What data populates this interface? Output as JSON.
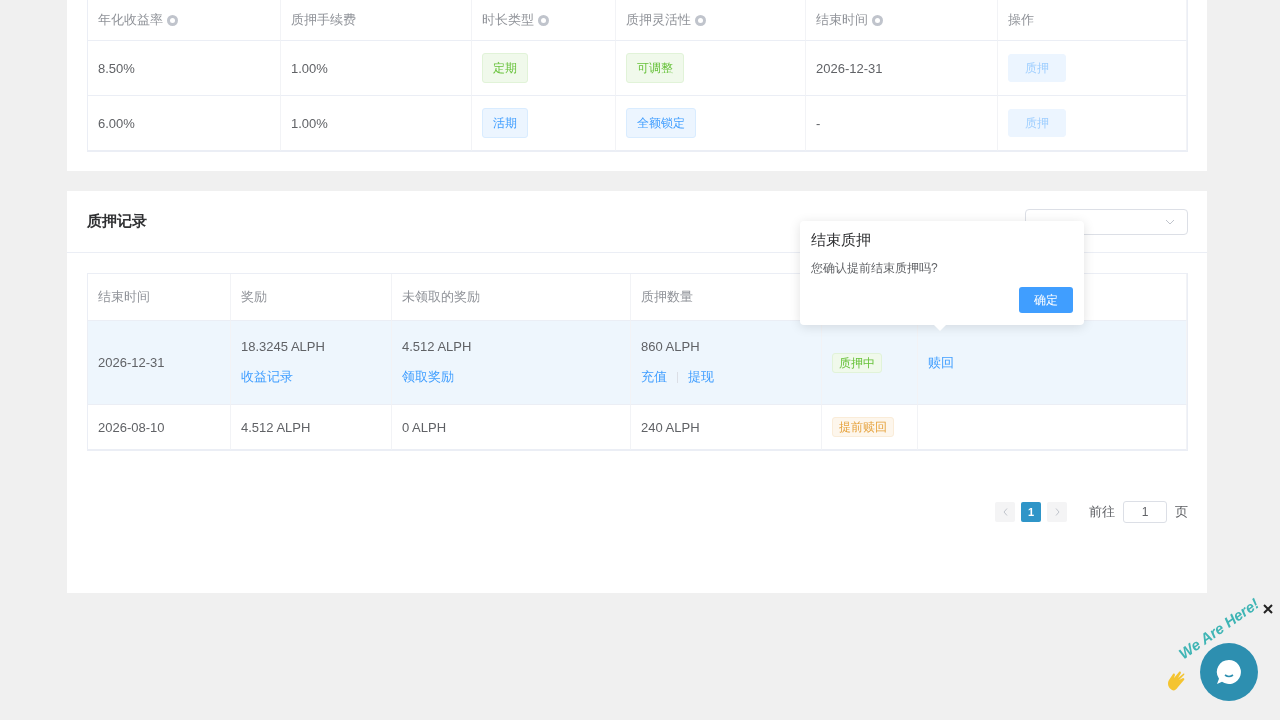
{
  "rates_table": {
    "columns": [
      {
        "label": "年化收益率",
        "help": true
      },
      {
        "label": "质押手续费",
        "help": false
      },
      {
        "label": "时长类型",
        "help": true
      },
      {
        "label": "质押灵活性",
        "help": true
      },
      {
        "label": "结束时间",
        "help": true
      },
      {
        "label": "操作",
        "help": false
      }
    ],
    "rows": [
      {
        "rate": "8.50%",
        "fee": "1.00%",
        "duration": {
          "text": "定期",
          "kind": "success"
        },
        "flexibility": {
          "text": "可调整",
          "kind": "success"
        },
        "end_time": "2026-12-31",
        "action": {
          "label": "质押",
          "disabled": true
        }
      },
      {
        "rate": "6.00%",
        "fee": "1.00%",
        "duration": {
          "text": "活期",
          "kind": "primary"
        },
        "flexibility": {
          "text": "全额锁定",
          "kind": "primary"
        },
        "end_time": "-",
        "action": {
          "label": "质押",
          "disabled": true
        }
      }
    ]
  },
  "records": {
    "title": "质押记录",
    "columns": [
      "结束时间",
      "奖励",
      "未领取的奖励",
      "质押数量"
    ],
    "rows": [
      {
        "highlighted": true,
        "end_time": "2026-12-31",
        "reward": "18.3245 ALPH",
        "reward_links": [
          "收益记录"
        ],
        "unclaimed": "4.512 ALPH",
        "unclaimed_links": [
          "领取奖励"
        ],
        "amount": "860 ALPH",
        "amount_links": [
          "充值",
          "提现"
        ],
        "status": {
          "text": "质押中",
          "kind": "success"
        },
        "action": "赎回"
      },
      {
        "highlighted": false,
        "end_time": "2026-08-10",
        "reward": "4.512 ALPH",
        "reward_links": [],
        "unclaimed": "0 ALPH",
        "unclaimed_links": [],
        "amount": "240 ALPH",
        "amount_links": [],
        "status": {
          "text": "提前赎回",
          "kind": "warning"
        }
      }
    ]
  },
  "popover": {
    "title": "结束质押",
    "message": "您确认提前结束质押吗?",
    "confirm": "确定"
  },
  "pagination": {
    "pages": [
      {
        "label": "1",
        "selected": true
      }
    ],
    "goto_label": "前往",
    "goto_value": "1",
    "page_suffix": "页"
  },
  "chat_widget": {
    "text": "We Are Here!"
  }
}
